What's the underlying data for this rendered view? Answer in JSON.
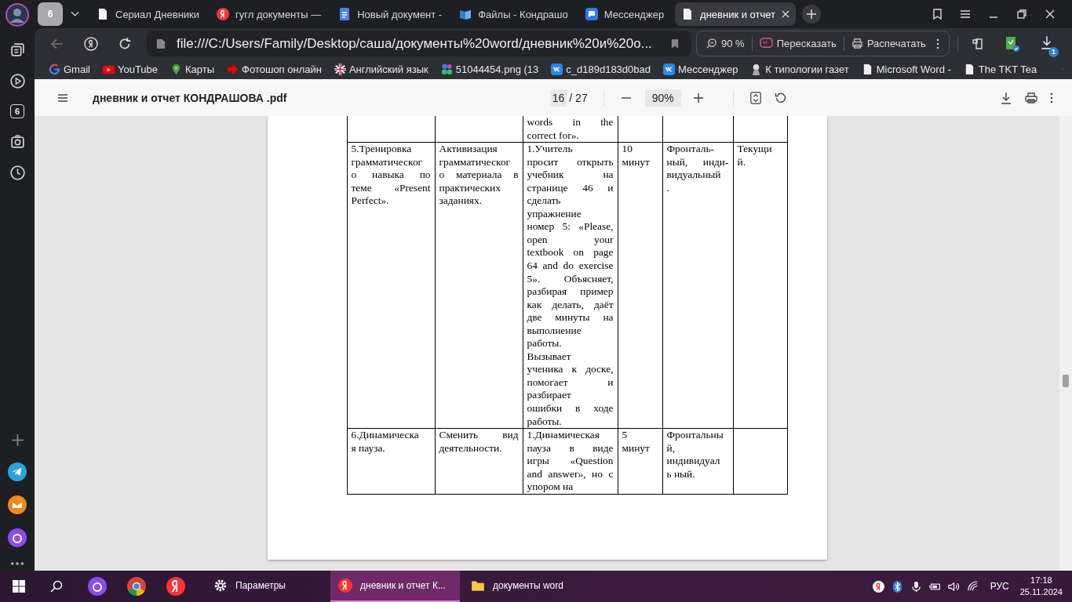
{
  "sidebar": {
    "tab_badge": "6"
  },
  "tab_group": {
    "count": "6"
  },
  "tabs": [
    {
      "label": "Сериал Дневники",
      "kind": "doc",
      "selected": false
    },
    {
      "label": "гугл документы —",
      "kind": "yandex",
      "selected": false
    },
    {
      "label": "Новый документ -",
      "kind": "gdoc",
      "selected": false
    },
    {
      "label": "Файлы - Кондрашо",
      "kind": "book",
      "selected": false
    },
    {
      "label": "Мессенджер",
      "kind": "chat",
      "selected": false
    },
    {
      "label": "дневник и отчет",
      "kind": "doc",
      "selected": true
    }
  ],
  "toolbar": {
    "url": "file:///C:/Users/Family/Desktop/саша/документы%20word/дневник%20и%20о...",
    "zoom": "90 %",
    "retell": "Пересказать",
    "print": "Распечатать",
    "downloads_badge": "1"
  },
  "bookmarks": [
    {
      "label": "Gmail",
      "kind": "google"
    },
    {
      "label": "YouTube",
      "kind": "youtube"
    },
    {
      "label": "Карты",
      "kind": "pin"
    },
    {
      "label": "Фотошоп онлайн",
      "kind": "arrow"
    },
    {
      "label": "Английский язык",
      "kind": "flag"
    },
    {
      "label": "51044454.png (13",
      "kind": "dots"
    },
    {
      "label": "c_d189d183d0bad",
      "kind": "vk"
    },
    {
      "label": "Мессенджер",
      "kind": "vk"
    },
    {
      "label": "К типологии газет",
      "kind": "figure"
    },
    {
      "label": "Microsoft Word -",
      "kind": "doc"
    },
    {
      "label": "The TKT Tea",
      "kind": "doc"
    }
  ],
  "pdf_toolbar": {
    "title": "дневник и отчет КОНДРАШОВА .pdf",
    "page": "16",
    "pages": "/ 27",
    "zoom": "90%"
  },
  "table": {
    "rows": [
      {
        "cells": [
          {},
          {},
          {
            "lines": [
              "words in the",
              "correct for»."
            ]
          },
          {},
          {},
          {}
        ]
      },
      {
        "cells": [
          {
            "lines": [
              "5.Тренировка",
              "грамматическог",
              "о навыка по",
              "теме «Present",
              "Perfect»."
            ]
          },
          {
            "lines": [
              "Активизация",
              "грамматическог",
              "о материала в",
              "практических",
              "заданиях."
            ]
          },
          {
            "lines": [
              "1.Учитель",
              "просит открыть",
              "учебник на",
              "странице 46 и",
              "сделать",
              "упражнение",
              "номер 5: «Please,",
              "open your",
              "textbook on page",
              "64 and do exercise",
              "5». Объясняет,",
              "разбирая пример",
              "как делать, даёт",
              "две минуты на",
              "выполнение",
              "работы.",
              "Вызывает",
              "ученика к доске,",
              "помогает и",
              "разбирает",
              "ошибки в ходе",
              "работы."
            ]
          },
          {
            "lines": [
              "10",
              "минут"
            ]
          },
          {
            "lines": [
              "Фронталь-",
              "ный, инди-",
              "видуальный",
              "."
            ]
          },
          {
            "lines": [
              "Текущи",
              "й."
            ]
          }
        ]
      },
      {
        "cells": [
          {
            "lines": [
              "6.Динамическа",
              "я пауза."
            ]
          },
          {
            "lines": [
              "Сменить вид",
              "деятельности."
            ]
          },
          {
            "lines": [
              "1.Динамическая",
              "пауза в виде",
              "игры «Question",
              "and answer», но с",
              "упором на"
            ]
          },
          {
            "lines": [
              "5",
              "минут"
            ]
          },
          {
            "lines": [
              "Фронтальны",
              "й,",
              "индивидуал",
              "ь ный."
            ]
          },
          {}
        ]
      }
    ]
  },
  "taskbar": {
    "items": [
      {
        "label": "Параметры",
        "kind": "gear",
        "selected": false
      },
      {
        "label": "дневник и отчет К...",
        "kind": "yandex",
        "selected": true
      },
      {
        "label": "документы word",
        "kind": "folder",
        "selected": false
      }
    ],
    "language": "РУС",
    "time": "17:18",
    "date": "25.11.2024"
  }
}
